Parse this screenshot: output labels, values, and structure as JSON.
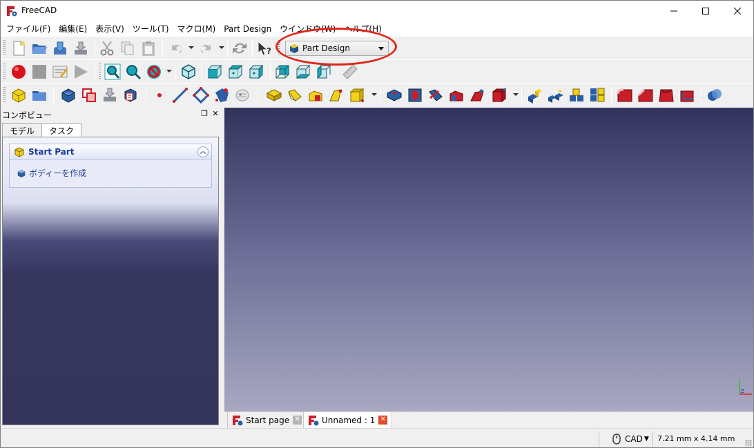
{
  "window": {
    "title": "FreeCAD"
  },
  "menu": [
    "ファイル(F)",
    "編集(E)",
    "表示(V)",
    "ツール(T)",
    "マクロ(M)",
    "Part Design",
    "ウインドウ(W)",
    "ヘルプ(H)"
  ],
  "workbench": {
    "selected": "Part Design"
  },
  "combo_view": {
    "title": "コンボビュー",
    "tabs": [
      "モデル",
      "タスク"
    ],
    "task_panel": {
      "title": "Start Part",
      "action": "ボディーを作成"
    }
  },
  "doc_tabs": [
    {
      "label": "Start page"
    },
    {
      "label": "Unnamed : 1"
    }
  ],
  "status": {
    "nav_style": "CAD",
    "dimensions": "7.21 mm x 4.14 mm"
  },
  "colors": {
    "highlight": "#e0241b",
    "task_title": "#1d3c9b",
    "cube_yellow": "#f2d21b",
    "cube_blue": "#2b5fa5",
    "solid_red": "#c81e2a",
    "teal": "#1aa4b8"
  }
}
